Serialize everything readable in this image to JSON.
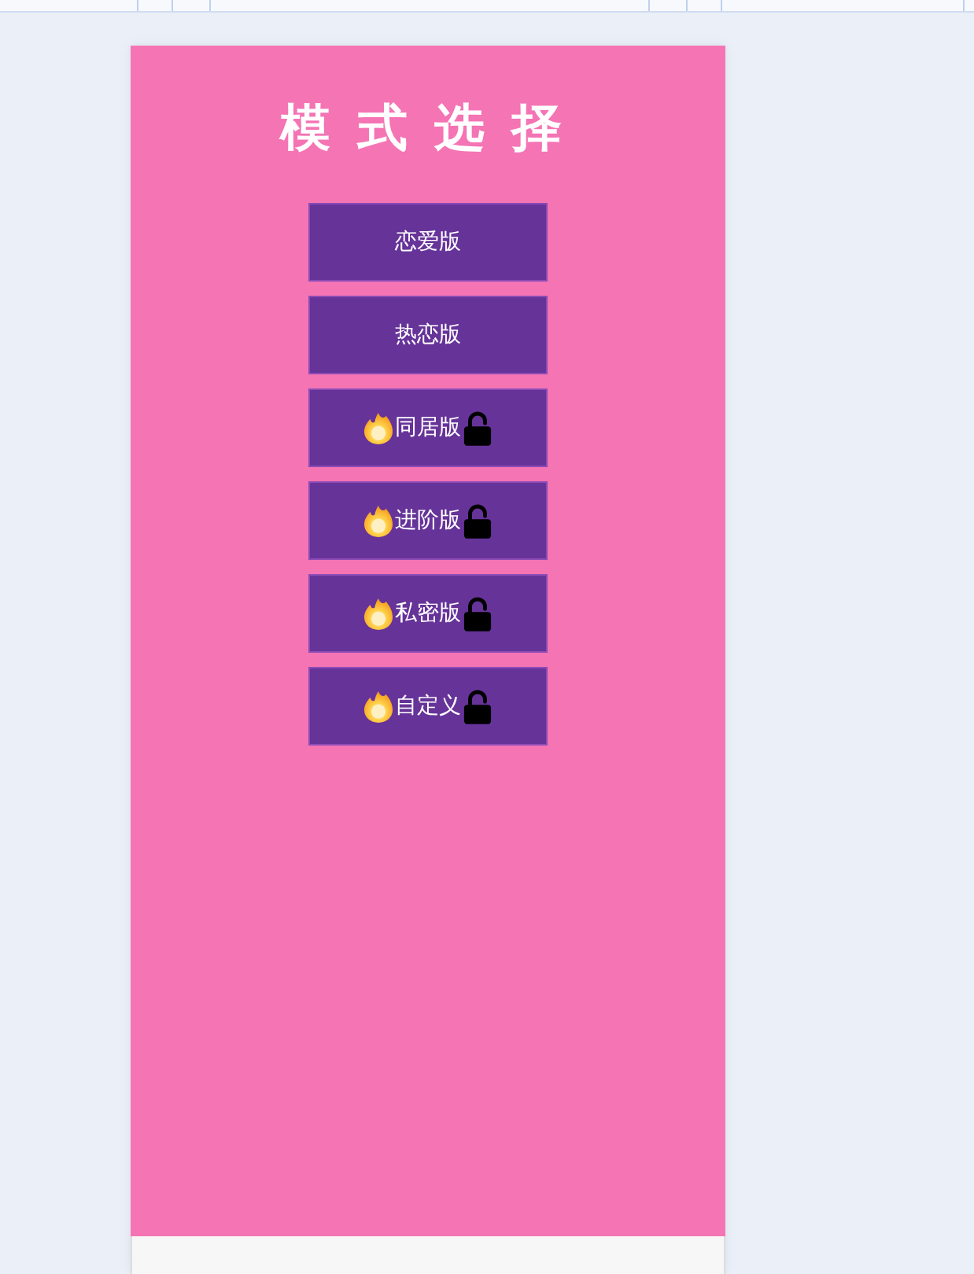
{
  "title": "模式选择",
  "modes": [
    {
      "label": "恋爱版",
      "locked": false
    },
    {
      "label": "热恋版",
      "locked": false
    },
    {
      "label": "同居版",
      "locked": true
    },
    {
      "label": "进阶版",
      "locked": true
    },
    {
      "label": "私密版",
      "locked": true
    },
    {
      "label": "自定义",
      "locked": true
    }
  ]
}
